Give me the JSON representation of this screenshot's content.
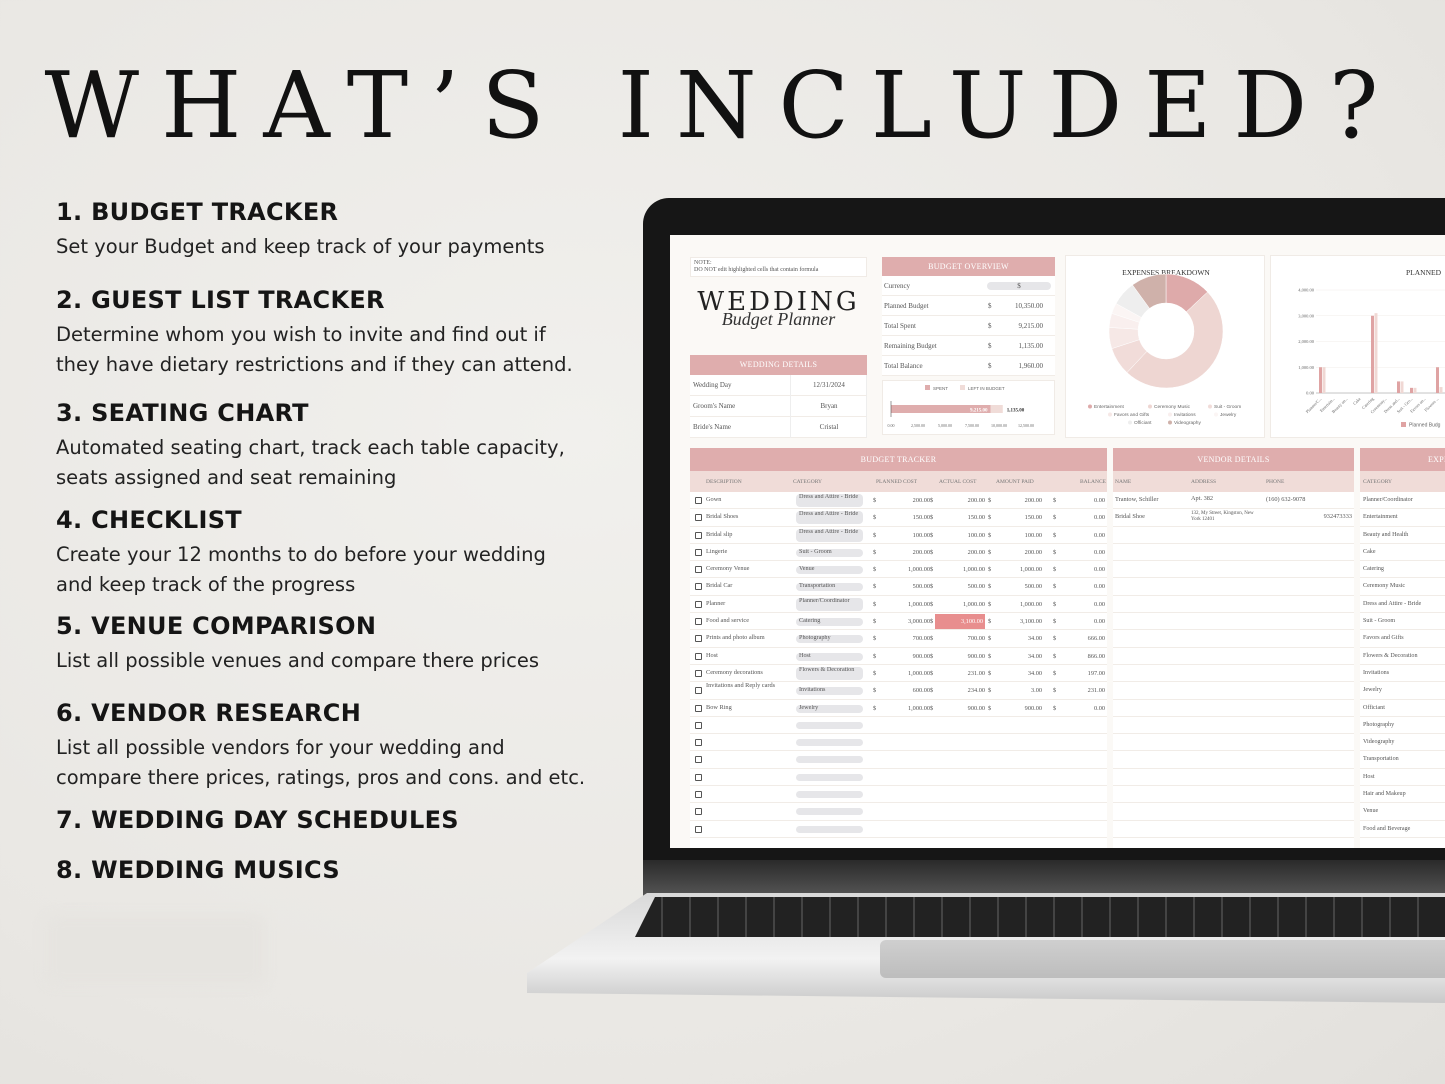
{
  "title": "WHAT’S INCLUDED?",
  "features": [
    {
      "heading": "1. BUDGET TRACKER",
      "desc": [
        "Set your Budget and keep track of your payments"
      ]
    },
    {
      "heading": "2. GUEST LIST TRACKER",
      "desc": [
        "Determine whom you wish to invite and find out if",
        "they have dietary restrictions and if they can attend."
      ]
    },
    {
      "heading": "3. SEATING CHART",
      "desc": [
        "Automated seating chart, track each table capacity,",
        "seats assigned and seat remaining"
      ]
    },
    {
      "heading": "4. CHECKLIST",
      "desc": [
        "Create your 12 months to do before your wedding",
        "and keep track of the progress"
      ]
    },
    {
      "heading": "5. VENUE COMPARISON",
      "desc": [
        "List all possible venues and compare there prices"
      ]
    },
    {
      "heading": "6. VENDOR RESEARCH",
      "desc": [
        "List all possible vendors for your wedding and",
        "compare there prices, ratings, pros and cons. and etc."
      ]
    },
    {
      "heading": "7. WEDDING DAY SCHEDULES",
      "desc": []
    },
    {
      "heading": "8. WEDDING MUSICS",
      "desc": []
    }
  ],
  "sheet": {
    "note": [
      "NOTE:",
      "DO NOT edit highlighted cells that contain formula"
    ],
    "logo": {
      "line1": "WEDDING",
      "line2": "Budget Planner"
    },
    "wedding_details": {
      "header": "WEDDING DETAILS",
      "rows": [
        [
          "Wedding Day",
          "12/31/2024"
        ],
        [
          "Groom's Name",
          "Bryan"
        ],
        [
          "Bride's Name",
          "Cristal"
        ]
      ]
    },
    "budget_overview": {
      "header": "BUDGET OVERVIEW",
      "currency_label": "Currency",
      "currency": "$",
      "rows": [
        [
          "Planned Budget",
          "$",
          "10,350.00"
        ],
        [
          "Total Spent",
          "$",
          "9,215.00"
        ],
        [
          "Remaining Budget",
          "$",
          "1,135.00"
        ],
        [
          "Total Balance",
          "$",
          "1,960.00"
        ]
      ]
    },
    "colors": {
      "accent": "#dfadad",
      "highlight": "#e88e8e",
      "light": "#f0dcd8"
    },
    "budget_tracker": {
      "header": "BUDGET TRACKER",
      "columns": [
        "DESCRIPTION",
        "CATEGORY",
        "PLANNED COST",
        "ACTUAL COST",
        "AMOUNT PAID",
        "BALANCE"
      ],
      "currency": "$",
      "rows": [
        [
          "Gown",
          "Dress and Attire - Bride",
          "200.00",
          "200.00",
          "200.00",
          "0.00"
        ],
        [
          "Bridal Shoes",
          "Dress and Attire - Bride",
          "150.00",
          "150.00",
          "150.00",
          "0.00"
        ],
        [
          "Bridal slip",
          "Dress and Attire - Bride",
          "100.00",
          "100.00",
          "100.00",
          "0.00"
        ],
        [
          "Lingerie",
          "Suit - Groom",
          "200.00",
          "200.00",
          "200.00",
          "0.00"
        ],
        [
          "Ceremony Venue",
          "Venue",
          "1,000.00",
          "1,000.00",
          "1,000.00",
          "0.00"
        ],
        [
          "Bridal Car",
          "Transportation",
          "500.00",
          "500.00",
          "500.00",
          "0.00"
        ],
        [
          "Planner",
          "Planner/Coordinator",
          "1,000.00",
          "1,000.00",
          "1,000.00",
          "0.00"
        ],
        [
          "Food and service",
          "Catering",
          "3,000.00",
          "3,100.00",
          "3,100.00",
          "0.00"
        ],
        [
          "Prints and photo album",
          "Photography",
          "700.00",
          "700.00",
          "34.00",
          "666.00"
        ],
        [
          "Host",
          "Host",
          "900.00",
          "900.00",
          "34.00",
          "866.00"
        ],
        [
          "Ceremony decorations",
          "Flowers & Decoration",
          "1,000.00",
          "231.00",
          "34.00",
          "197.00"
        ],
        [
          "Invitations and Reply cards",
          "Invitations",
          "600.00",
          "234.00",
          "3.00",
          "231.00"
        ],
        [
          "Bow Ring",
          "Jewelry",
          "1,000.00",
          "900.00",
          "900.00",
          "0.00"
        ]
      ],
      "highlighted_cell": "3,100.00",
      "empty_rows": 7
    },
    "vendor_details": {
      "header": "VENDOR DETAILS",
      "columns": [
        "NAME",
        "ADDRESS",
        "PHONE"
      ],
      "rows": [
        [
          "Trantow, Schiller",
          "Apt. 382",
          "(160) 632-9078"
        ],
        [
          "Bridal Shoe",
          "132, My Street, Kingston, New York 12401",
          "932473333"
        ]
      ]
    },
    "expenses": {
      "header": "EXPENS",
      "column": "CATEGORY",
      "items": [
        "Planner/Coordinator",
        "Entertainment",
        "Beauty and Health",
        "Cake",
        "Catering",
        "Ceremony Music",
        "Dress and Attire - Bride",
        "Suit - Groom",
        "Favors and Gifts",
        "Flowers & Decoration",
        "Invitations",
        "Jewelry",
        "Officiant",
        "Photography",
        "Videography",
        "Transportation",
        "Host",
        "Hair and Makeup",
        "Venue",
        "Food and Beverage"
      ]
    }
  },
  "chart_data": [
    {
      "type": "bar",
      "orientation": "horizontal",
      "stacked": true,
      "legend": [
        "SPENT",
        "LEFT IN BUDGET"
      ],
      "legend_placement": "top",
      "values": {
        "SPENT": 9215,
        "LEFT IN BUDGET": 1135
      },
      "data_labels": [
        "9,215.00",
        "1,135.00"
      ],
      "xlim": [
        0,
        12500
      ],
      "xticks": [
        "0.00",
        "2,500.00",
        "5,000.00",
        "7,500.00",
        "10,000.00",
        "12,500.00"
      ],
      "colors": [
        "#dfadad",
        "#f0dcd8"
      ]
    },
    {
      "type": "pie",
      "donut": true,
      "title": "EXPENSES BREAKDOWN",
      "legend_placement": "bottom",
      "labels": [
        "Entertainment",
        "Ceremony Music",
        "Suit - Groom",
        "Favors and Gifts",
        "Invitations",
        "Jewelry",
        "Officiant",
        "Videography"
      ],
      "values": [
        13,
        49,
        8,
        6,
        4,
        3,
        7,
        10
      ],
      "colors": [
        "#deaaaa",
        "#eed6d2",
        "#f1dcd9",
        "#f6e8e6",
        "#f9efee",
        "#fbf5f4",
        "#eeeeee",
        "#cfb1aa"
      ]
    },
    {
      "type": "bar",
      "title": "PLANNED",
      "ylim": [
        0,
        4000
      ],
      "yticks": [
        "0.00",
        "1,000.00",
        "2,000.00",
        "3,000.00",
        "4,000.00"
      ],
      "grid": true,
      "legend_placement": "bottom",
      "categories": [
        "Planner/C...",
        "Entertain...",
        "Beauty an...",
        "Cake",
        "Catering",
        "Ceremony...",
        "Dress and...",
        "Suit - Gro...",
        "Favors an...",
        "Flowers ..."
      ],
      "series": [
        {
          "name": "Planned Budg",
          "values": [
            1000,
            0,
            0,
            0,
            3000,
            0,
            450,
            200,
            0,
            1000
          ],
          "color": "#dfa3a3"
        },
        {
          "values": [
            1000,
            0,
            0,
            0,
            3100,
            0,
            450,
            200,
            0,
            231
          ],
          "color": "#f0d8d4"
        }
      ]
    }
  ]
}
